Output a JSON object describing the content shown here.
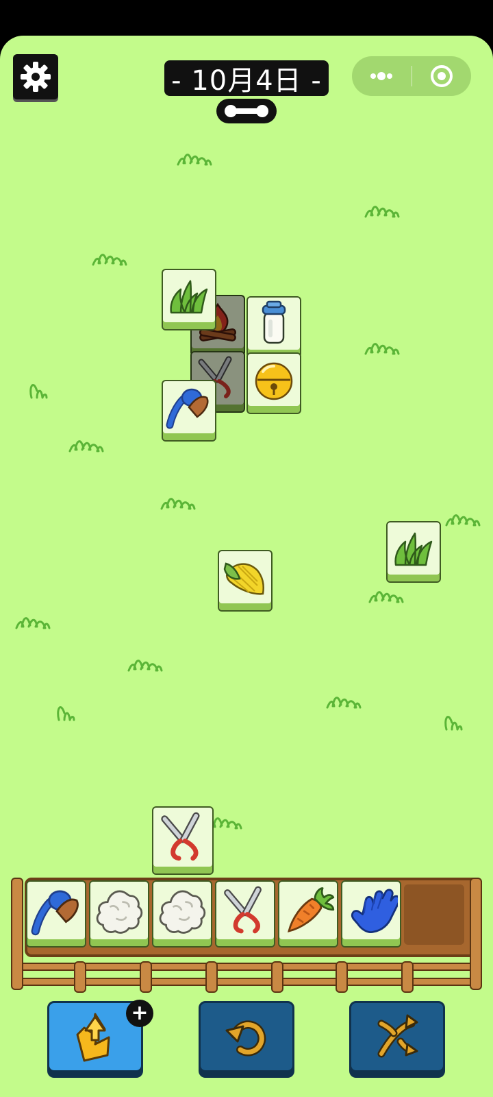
{
  "header": {
    "date": "- 10月4日 -",
    "settings_icon": "gear-icon",
    "progress_icon": "bone-progress-icon",
    "capsule_more_icon": "more-dots-icon",
    "capsule_close_icon": "target-circle-icon"
  },
  "board": {
    "tiles": [
      "grass",
      "campfire",
      "milk-bottle",
      "shears",
      "golden-bell",
      "brush",
      "grass",
      "corn",
      "shears"
    ]
  },
  "tray": {
    "slots": [
      "brush",
      "cotton",
      "cotton",
      "shears",
      "carrot",
      "glove"
    ],
    "capacity": 7
  },
  "powerups": {
    "move_out_icon": "tray-out-icon",
    "undo_icon": "undo-icon",
    "shuffle_icon": "shuffle-icon",
    "add_icon": "plus-icon",
    "add_label": "+"
  },
  "colors": {
    "background": "#c3fb8b",
    "tile_face": "#eefbd9",
    "tile_base": "#90c652",
    "button_active": "#3aa0ea",
    "button_dark": "#1d5b8a",
    "tray_wood": "#a7672e"
  }
}
